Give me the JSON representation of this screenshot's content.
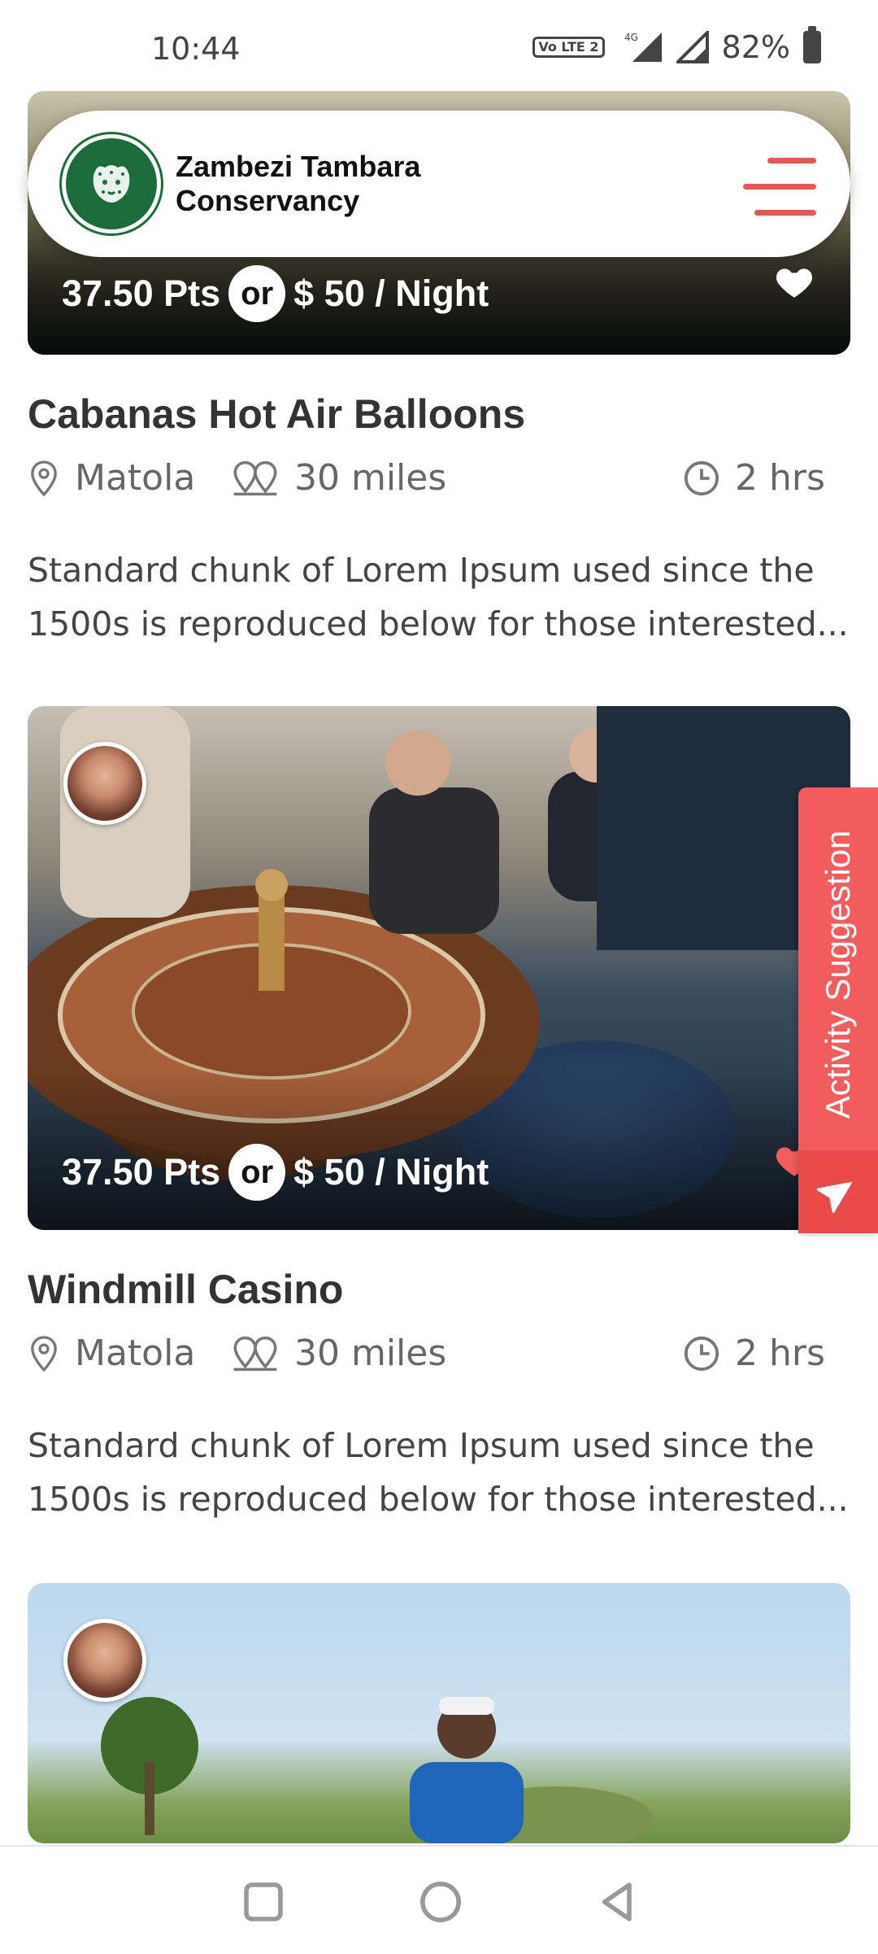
{
  "status_bar": {
    "time": "10:44",
    "volte": "Vo LTE 2",
    "network": "4G",
    "battery": "82%"
  },
  "header": {
    "brand_line1": "Zambezi Tambara",
    "brand_line2": "Conservancy",
    "logo_icon": "leopard-logo-icon",
    "menu_icon": "hamburger-menu-icon"
  },
  "accent_color": "#f25c5c",
  "cards": [
    {
      "price_pts": "37.50 Pts",
      "or": "or",
      "price_usd": "$ 50 / Night",
      "title": "Cabanas Hot Air Balloons",
      "location": "Matola",
      "distance": "30 miles",
      "duration": "2 hrs",
      "description": "Standard chunk of Lorem Ipsum used since the 1500s is reproduced below for those interested..."
    },
    {
      "price_pts": "37.50 Pts",
      "or": "or",
      "price_usd": "$ 50 / Night",
      "title": "Windmill Casino",
      "location": "Matola",
      "distance": "30 miles",
      "duration": "2 hrs",
      "description": "Standard chunk of Lorem Ipsum used since the 1500s is reproduced below for those interested..."
    },
    {
      "image": "golf-course"
    }
  ],
  "activity_suggestion": {
    "label": "Activity Suggestion",
    "icon": "send-icon"
  },
  "nav": {
    "recents": "square-icon",
    "home": "circle-icon",
    "back": "triangle-back-icon"
  }
}
